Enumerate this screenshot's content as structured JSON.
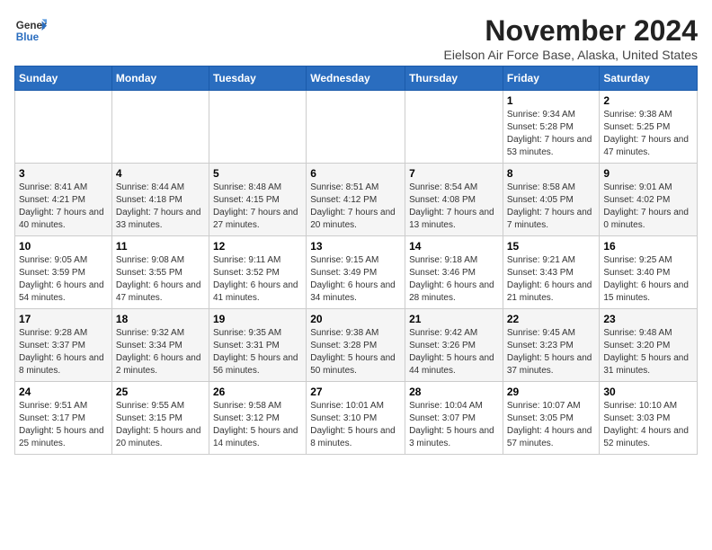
{
  "logo": {
    "line1": "General",
    "line2": "Blue"
  },
  "title": "November 2024",
  "subtitle": "Eielson Air Force Base, Alaska, United States",
  "calendar": {
    "headers": [
      "Sunday",
      "Monday",
      "Tuesday",
      "Wednesday",
      "Thursday",
      "Friday",
      "Saturday"
    ],
    "weeks": [
      [
        {
          "day": "",
          "sunrise": "",
          "sunset": "",
          "daylight": ""
        },
        {
          "day": "",
          "sunrise": "",
          "sunset": "",
          "daylight": ""
        },
        {
          "day": "",
          "sunrise": "",
          "sunset": "",
          "daylight": ""
        },
        {
          "day": "",
          "sunrise": "",
          "sunset": "",
          "daylight": ""
        },
        {
          "day": "",
          "sunrise": "",
          "sunset": "",
          "daylight": ""
        },
        {
          "day": "1",
          "sunrise": "Sunrise: 9:34 AM",
          "sunset": "Sunset: 5:28 PM",
          "daylight": "Daylight: 7 hours and 53 minutes."
        },
        {
          "day": "2",
          "sunrise": "Sunrise: 9:38 AM",
          "sunset": "Sunset: 5:25 PM",
          "daylight": "Daylight: 7 hours and 47 minutes."
        }
      ],
      [
        {
          "day": "3",
          "sunrise": "Sunrise: 8:41 AM",
          "sunset": "Sunset: 4:21 PM",
          "daylight": "Daylight: 7 hours and 40 minutes."
        },
        {
          "day": "4",
          "sunrise": "Sunrise: 8:44 AM",
          "sunset": "Sunset: 4:18 PM",
          "daylight": "Daylight: 7 hours and 33 minutes."
        },
        {
          "day": "5",
          "sunrise": "Sunrise: 8:48 AM",
          "sunset": "Sunset: 4:15 PM",
          "daylight": "Daylight: 7 hours and 27 minutes."
        },
        {
          "day": "6",
          "sunrise": "Sunrise: 8:51 AM",
          "sunset": "Sunset: 4:12 PM",
          "daylight": "Daylight: 7 hours and 20 minutes."
        },
        {
          "day": "7",
          "sunrise": "Sunrise: 8:54 AM",
          "sunset": "Sunset: 4:08 PM",
          "daylight": "Daylight: 7 hours and 13 minutes."
        },
        {
          "day": "8",
          "sunrise": "Sunrise: 8:58 AM",
          "sunset": "Sunset: 4:05 PM",
          "daylight": "Daylight: 7 hours and 7 minutes."
        },
        {
          "day": "9",
          "sunrise": "Sunrise: 9:01 AM",
          "sunset": "Sunset: 4:02 PM",
          "daylight": "Daylight: 7 hours and 0 minutes."
        }
      ],
      [
        {
          "day": "10",
          "sunrise": "Sunrise: 9:05 AM",
          "sunset": "Sunset: 3:59 PM",
          "daylight": "Daylight: 6 hours and 54 minutes."
        },
        {
          "day": "11",
          "sunrise": "Sunrise: 9:08 AM",
          "sunset": "Sunset: 3:55 PM",
          "daylight": "Daylight: 6 hours and 47 minutes."
        },
        {
          "day": "12",
          "sunrise": "Sunrise: 9:11 AM",
          "sunset": "Sunset: 3:52 PM",
          "daylight": "Daylight: 6 hours and 41 minutes."
        },
        {
          "day": "13",
          "sunrise": "Sunrise: 9:15 AM",
          "sunset": "Sunset: 3:49 PM",
          "daylight": "Daylight: 6 hours and 34 minutes."
        },
        {
          "day": "14",
          "sunrise": "Sunrise: 9:18 AM",
          "sunset": "Sunset: 3:46 PM",
          "daylight": "Daylight: 6 hours and 28 minutes."
        },
        {
          "day": "15",
          "sunrise": "Sunrise: 9:21 AM",
          "sunset": "Sunset: 3:43 PM",
          "daylight": "Daylight: 6 hours and 21 minutes."
        },
        {
          "day": "16",
          "sunrise": "Sunrise: 9:25 AM",
          "sunset": "Sunset: 3:40 PM",
          "daylight": "Daylight: 6 hours and 15 minutes."
        }
      ],
      [
        {
          "day": "17",
          "sunrise": "Sunrise: 9:28 AM",
          "sunset": "Sunset: 3:37 PM",
          "daylight": "Daylight: 6 hours and 8 minutes."
        },
        {
          "day": "18",
          "sunrise": "Sunrise: 9:32 AM",
          "sunset": "Sunset: 3:34 PM",
          "daylight": "Daylight: 6 hours and 2 minutes."
        },
        {
          "day": "19",
          "sunrise": "Sunrise: 9:35 AM",
          "sunset": "Sunset: 3:31 PM",
          "daylight": "Daylight: 5 hours and 56 minutes."
        },
        {
          "day": "20",
          "sunrise": "Sunrise: 9:38 AM",
          "sunset": "Sunset: 3:28 PM",
          "daylight": "Daylight: 5 hours and 50 minutes."
        },
        {
          "day": "21",
          "sunrise": "Sunrise: 9:42 AM",
          "sunset": "Sunset: 3:26 PM",
          "daylight": "Daylight: 5 hours and 44 minutes."
        },
        {
          "day": "22",
          "sunrise": "Sunrise: 9:45 AM",
          "sunset": "Sunset: 3:23 PM",
          "daylight": "Daylight: 5 hours and 37 minutes."
        },
        {
          "day": "23",
          "sunrise": "Sunrise: 9:48 AM",
          "sunset": "Sunset: 3:20 PM",
          "daylight": "Daylight: 5 hours and 31 minutes."
        }
      ],
      [
        {
          "day": "24",
          "sunrise": "Sunrise: 9:51 AM",
          "sunset": "Sunset: 3:17 PM",
          "daylight": "Daylight: 5 hours and 25 minutes."
        },
        {
          "day": "25",
          "sunrise": "Sunrise: 9:55 AM",
          "sunset": "Sunset: 3:15 PM",
          "daylight": "Daylight: 5 hours and 20 minutes."
        },
        {
          "day": "26",
          "sunrise": "Sunrise: 9:58 AM",
          "sunset": "Sunset: 3:12 PM",
          "daylight": "Daylight: 5 hours and 14 minutes."
        },
        {
          "day": "27",
          "sunrise": "Sunrise: 10:01 AM",
          "sunset": "Sunset: 3:10 PM",
          "daylight": "Daylight: 5 hours and 8 minutes."
        },
        {
          "day": "28",
          "sunrise": "Sunrise: 10:04 AM",
          "sunset": "Sunset: 3:07 PM",
          "daylight": "Daylight: 5 hours and 3 minutes."
        },
        {
          "day": "29",
          "sunrise": "Sunrise: 10:07 AM",
          "sunset": "Sunset: 3:05 PM",
          "daylight": "Daylight: 4 hours and 57 minutes."
        },
        {
          "day": "30",
          "sunrise": "Sunrise: 10:10 AM",
          "sunset": "Sunset: 3:03 PM",
          "daylight": "Daylight: 4 hours and 52 minutes."
        }
      ]
    ]
  }
}
